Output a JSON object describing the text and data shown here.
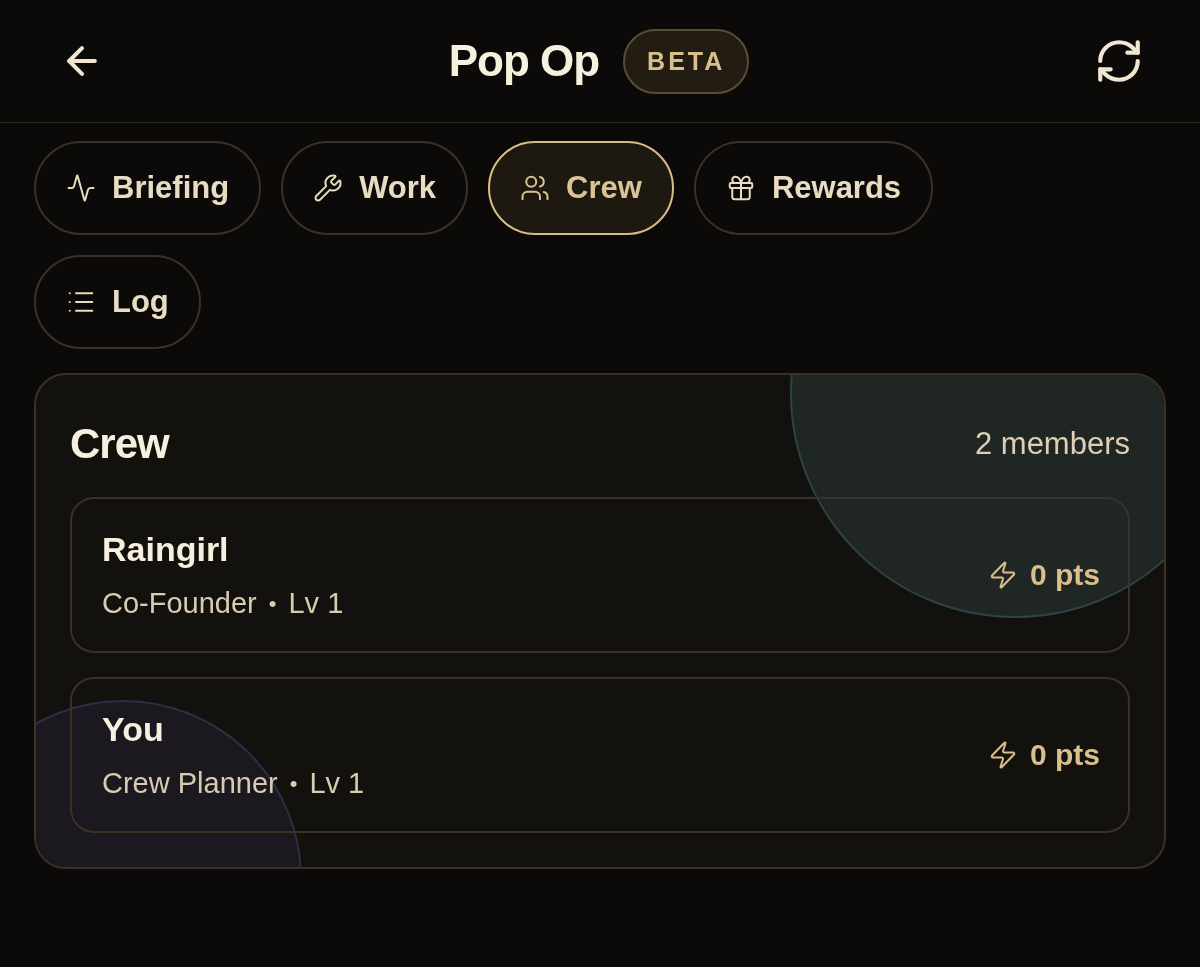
{
  "header": {
    "title": "Pop Op",
    "badge": "BETA"
  },
  "tabs": [
    {
      "label": "Briefing",
      "kind": "briefing",
      "selected": false
    },
    {
      "label": "Work",
      "kind": "work",
      "selected": false
    },
    {
      "label": "Crew",
      "kind": "crew",
      "selected": true
    },
    {
      "label": "Rewards",
      "kind": "rewards",
      "selected": false
    },
    {
      "label": "Log",
      "kind": "log",
      "selected": false
    }
  ],
  "crew": {
    "title": "Crew",
    "count": "2 members",
    "members": [
      {
        "name": "Raingirl",
        "role": "Co-Founder",
        "separator": "•",
        "level": "Lv 1",
        "points": "0 pts"
      },
      {
        "name": "You",
        "role": "Crew Planner",
        "separator": "•",
        "level": "Lv 1",
        "points": "0 pts"
      }
    ]
  }
}
